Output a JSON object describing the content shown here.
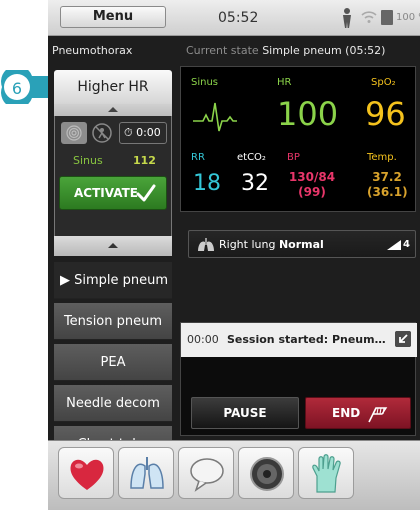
{
  "statusbar": {
    "menu_label": "Menu",
    "clock": "05:52",
    "battery": "100 %"
  },
  "scenario": {
    "name": "Pneumothorax",
    "current_state_prefix": "Current state",
    "current_state_value": "Simple pneum (05:52)"
  },
  "callout": {
    "number": "6"
  },
  "controls": {
    "next_state_label": "Higher HR",
    "timer": "0:00",
    "rhythm_label": "Sinus",
    "rhythm_value": "112",
    "activate_label": "ACTIVATE"
  },
  "states": [
    {
      "label": "Simple pneum"
    },
    {
      "label": "Tension pneum"
    },
    {
      "label": "PEA"
    },
    {
      "label": "Needle decom"
    },
    {
      "label": "Chest tube"
    }
  ],
  "vitals": {
    "rhythm_label": "Sinus",
    "hr_label": "HR",
    "hr_value": "100",
    "spo2_label": "SpO₂",
    "spo2_value": "96",
    "rr_label": "RR",
    "rr_value": "18",
    "etco2_label": "etCO₂",
    "etco2_value": "32",
    "bp_label": "BP",
    "bp_value": "130/84",
    "bp_mean": "(99)",
    "temp_label": "Temp.",
    "temp_value": "37.2",
    "temp_secondary": "(36.1)",
    "colors": {
      "hr": "#8bd34a",
      "spo2": "#f4c21d",
      "rr": "#34c6d6",
      "bp": "#e8366a",
      "temp": "#d8a22c"
    }
  },
  "lung": {
    "label_prefix": "Right lung",
    "label_value": "Normal",
    "level": "4"
  },
  "log": {
    "time": "00:00",
    "message": "Session started: Pneumothorax",
    "pause_label": "PAUSE",
    "end_label": "END"
  },
  "toolbar": {
    "items": [
      "heart-icon",
      "lungs-icon",
      "speech-bubble-icon",
      "speaker-icon",
      "glove-icon"
    ]
  }
}
